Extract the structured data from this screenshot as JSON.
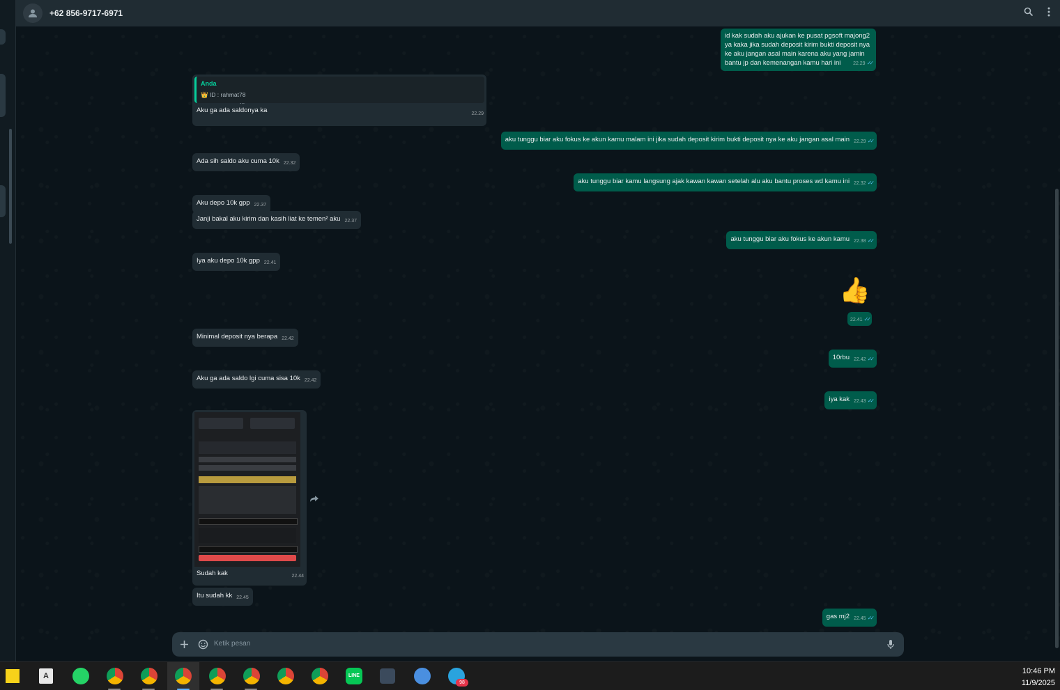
{
  "header": {
    "contact": "+62 856-9717-6971"
  },
  "reply_preview": {
    "author": "Anda",
    "text": "👑 ID : rahmat78",
    "extra": "..."
  },
  "messages": {
    "m1": {
      "text": "id kak sudah aku ajukan ke pusat pgsoft majong2 ya kaka jika sudah deposit kirim bukti deposit nya ke aku jangan asal main karena aku yang jamin bantu jp dan kemenangan kamu hari ini",
      "time": "22.29"
    },
    "m2": {
      "text": "Aku ga ada saldonya ka",
      "time": "22.29"
    },
    "m3": {
      "text": "aku tunggu biar aku fokus ke akun kamu malam ini jika sudah deposit kirim bukti deposit nya ke aku jangan asal main",
      "time": "22.29"
    },
    "m4": {
      "text": "Ada sih saldo aku cuma 10k",
      "time": "22.32"
    },
    "m5": {
      "text": "aku tunggu biar kamu langsung ajak kawan kawan setelah alu aku bantu proses wd kamu ini",
      "time": "22.32"
    },
    "m6": {
      "text": "Aku depo 10k gpp",
      "time": "22.37"
    },
    "m7": {
      "text": "Janji bakal aku kirim dan kasih liat ke temen² aku",
      "time": "22.37"
    },
    "m8": {
      "text": "aku tunggu biar aku fokus ke akun kamu",
      "time": "22.38"
    },
    "m9": {
      "text": "Iya aku depo 10k gpp",
      "time": "22.41"
    },
    "m10": {
      "text": "👍",
      "time": "22.41"
    },
    "m11": {
      "text": "Minimal deposit nya berapa",
      "time": "22.42"
    },
    "m12": {
      "text": "10rbu",
      "time": "22.42"
    },
    "m13": {
      "text": "Aku ga ada saldo lgi cuma sisa 10k",
      "time": "22.42"
    },
    "m14": {
      "text": "iya kak",
      "time": "22.43"
    },
    "m15": {
      "text": "Sudah kak",
      "time": "22.44"
    },
    "m16": {
      "text": "Itu sudah kk",
      "time": "22.45"
    },
    "m17": {
      "text": "gas mj2",
      "time": "22.45"
    }
  },
  "ticks": "✓✓",
  "composer": {
    "placeholder": "Ketik pesan"
  },
  "taskbar": {
    "time": "10:46 PM",
    "date": "11/9/2025",
    "telegram_badge": "98"
  },
  "colors": {
    "outgoing": "#005c4b",
    "incoming": "#202c33",
    "accent": "#06cf9c",
    "tick": "#53bdeb"
  }
}
